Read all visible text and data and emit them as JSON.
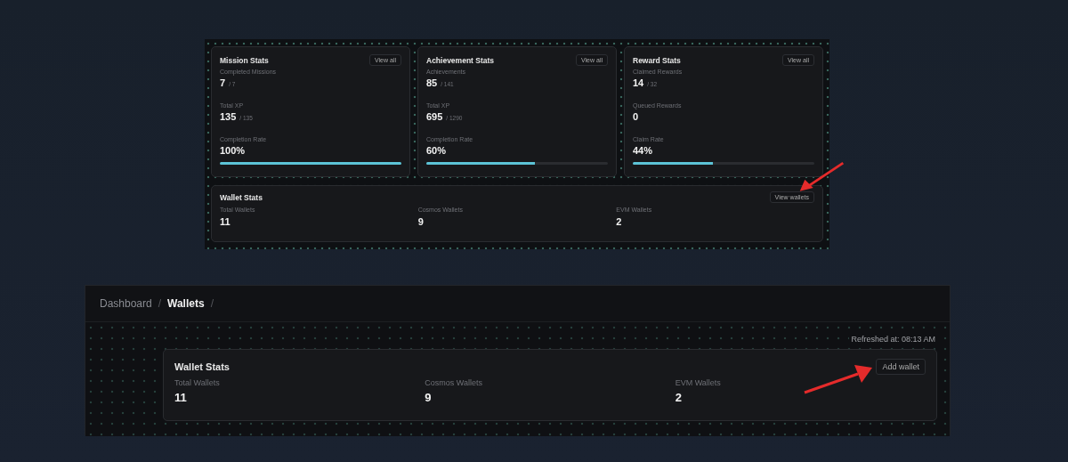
{
  "overview": {
    "stat_cards": [
      {
        "title": "Mission Stats",
        "action": "View all",
        "metrics": [
          {
            "label": "Completed Missions",
            "value": "7",
            "total": "/ 7"
          },
          {
            "label": "Total XP",
            "value": "135",
            "total": "/ 135"
          },
          {
            "label": "Completion Rate",
            "value": "100%",
            "level": 1
          }
        ]
      },
      {
        "title": "Achievement Stats",
        "action": "View all",
        "metrics": [
          {
            "label": "Achievements",
            "value": "85",
            "total": "/ 141"
          },
          {
            "label": "Total XP",
            "value": "695",
            "total": "/ 1290"
          },
          {
            "label": "Completion Rate",
            "value": "60%",
            "level": 0.6
          }
        ]
      },
      {
        "title": "Reward Stats",
        "action": "View all",
        "metrics": [
          {
            "label": "Claimed Rewards",
            "value": "14",
            "total": "/ 32"
          },
          {
            "label": "Queued Rewards",
            "value": "0"
          },
          {
            "label": "Claim Rate",
            "value": "44%",
            "level": 0.44
          }
        ]
      }
    ],
    "wallet_stats": {
      "title": "Wallet Stats",
      "action": "View wallets",
      "metrics": [
        {
          "label": "Total Wallets",
          "value": "11"
        },
        {
          "label": "Cosmos Wallets",
          "value": "9"
        },
        {
          "label": "EVM Wallets",
          "value": "2"
        }
      ]
    }
  },
  "wallets_page": {
    "breadcrumb": [
      {
        "label": "Dashboard",
        "current": false,
        "separator": "/"
      },
      {
        "label": "Wallets",
        "current": true,
        "separator": "/"
      }
    ],
    "refreshed": "Refreshed at: 08:13 AM",
    "wallet_stats": {
      "title": "Wallet Stats",
      "action": "Add wallet",
      "metrics": [
        {
          "label": "Total Wallets",
          "value": "11"
        },
        {
          "label": "Cosmos Wallets",
          "value": "9"
        },
        {
          "label": "EVM Wallets",
          "value": "2"
        }
      ]
    }
  }
}
